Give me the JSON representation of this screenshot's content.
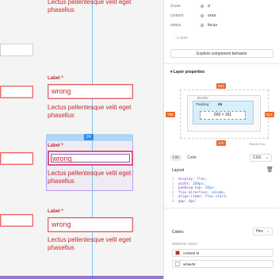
{
  "canvas": {
    "groups": [
      {
        "label": "",
        "value": "",
        "help": "Lectus pellentesque velit eget phasellus"
      },
      {
        "label": "Label *",
        "value": "wrong",
        "help": "Lectus pellentesque velit eget phasellus"
      },
      {
        "label": "Label *",
        "value": "wrong",
        "help": "Lectus pellentesque velit eget phasellus"
      },
      {
        "label": "Label *",
        "value": "wrong",
        "help": "Lectus pellentesque velit eget phasellus"
      }
    ],
    "selection_badge": "24"
  },
  "panel": {
    "props": [
      {
        "key": "Zoom",
        "value": "d"
      },
      {
        "key": "content",
        "value": "error"
      },
      {
        "key": "status",
        "value": "focus"
      }
    ],
    "more_label": "1 more",
    "explore_button": "Explore component behavior",
    "layer_properties_title": "Layer properties",
    "box_model": {
      "border_label": "Border",
      "padding_label": "Padding",
      "padding_value": "24",
      "size": "269 × 161",
      "margin_top": "633",
      "margin_left": "798",
      "margin_right": "513",
      "margin_bottom": "270",
      "border_box_label": "Border box"
    },
    "tabs": [
      "List",
      "Code"
    ],
    "css_label": "CSS",
    "layout_title": "Layout",
    "code_lines": [
      {
        "n": "1",
        "prop": "display",
        "val": "flex;"
      },
      {
        "n": "2",
        "prop": "width",
        "val": "269px;"
      },
      {
        "n": "3",
        "prop": "padding-top",
        "val": "24px;"
      },
      {
        "n": "4",
        "prop": "flex-direction",
        "val": "column;"
      },
      {
        "n": "5",
        "prop": "align-items",
        "val": "flex-start;"
      },
      {
        "n": "6",
        "prop": "gap",
        "val": "4px;"
      }
    ],
    "colors_title": "Colors",
    "hex_label": "Hex",
    "selection_colors_title": "Selection colors",
    "colors": [
      {
        "name": "red/600 M",
        "hex": "#c62828"
      },
      {
        "name": "white/M",
        "hex": "#ffffff"
      }
    ]
  }
}
